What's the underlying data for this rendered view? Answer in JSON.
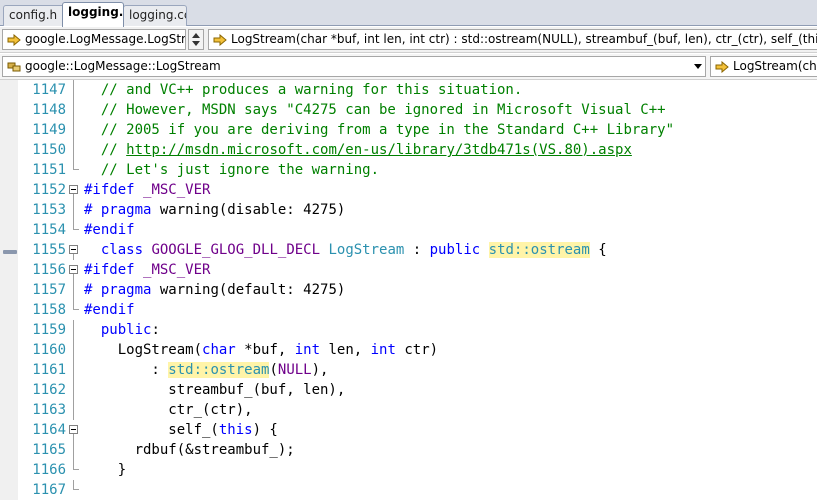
{
  "tabs": [
    {
      "label": "config.h",
      "active": false
    },
    {
      "label": "logging.h",
      "active": true
    },
    {
      "label": "logging.cc",
      "active": false
    }
  ],
  "nav": {
    "scope_combo": "google.LogMessage.LogStr",
    "member_combo": "LogStream(char *buf, int len, int ctr) : std::ostream(NULL), streambuf_(buf, len), ctr_(ctr), self_(this)",
    "class_combo": "google::LogMessage::LogStream",
    "method_combo": "LogStream(char"
  },
  "icons": {
    "member": "arrow-right-icon",
    "class": "class-icon",
    "fold": "collapse-box-icon",
    "margin": "breakpoint-margin-marker"
  },
  "colors": {
    "comment": "#008000",
    "keyword": "#0000ff",
    "macro": "#6f008a",
    "type": "#2b91af",
    "highlight": "#fff4a8"
  },
  "editor": {
    "lines": [
      {
        "num": "1147",
        "fold": "none",
        "tokens": [
          {
            "t": "  // and VC++ produces a warning for this situation.",
            "c": "c"
          }
        ]
      },
      {
        "num": "1148",
        "fold": "none",
        "tokens": [
          {
            "t": "  // However, MSDN says \"C4275 can be ignored in Microsoft Visual C++",
            "c": "c"
          }
        ]
      },
      {
        "num": "1149",
        "fold": "none",
        "tokens": [
          {
            "t": "  // 2005 if you are deriving from a type in the Standard C++ Library\"",
            "c": "c"
          }
        ]
      },
      {
        "num": "1150",
        "fold": "none",
        "tokens": [
          {
            "t": "  // ",
            "c": "c"
          },
          {
            "t": "http://msdn.microsoft.com/en-us/library/3tdb471s(VS.80).aspx",
            "c": "url"
          }
        ]
      },
      {
        "num": "1151",
        "fold": "end",
        "tokens": [
          {
            "t": "  // Let's just ignore the warning.",
            "c": "c"
          }
        ]
      },
      {
        "num": "1152",
        "fold": "box",
        "tokens": [
          {
            "t": "#ifdef",
            "c": "d"
          },
          {
            "t": " ",
            "c": ""
          },
          {
            "t": "_MSC_VER",
            "c": "m"
          }
        ]
      },
      {
        "num": "1153",
        "fold": "none",
        "tokens": [
          {
            "t": "# pragma",
            "c": "d"
          },
          {
            "t": " warning(disable: 4275)",
            "c": ""
          }
        ]
      },
      {
        "num": "1154",
        "fold": "end",
        "tokens": [
          {
            "t": "#endif",
            "c": "d"
          }
        ]
      },
      {
        "num": "1155",
        "fold": "box",
        "tokens": [
          {
            "t": "  ",
            "c": ""
          },
          {
            "t": "class",
            "c": "k"
          },
          {
            "t": " ",
            "c": ""
          },
          {
            "t": "GOOGLE_GLOG_DLL_DECL",
            "c": "m"
          },
          {
            "t": " ",
            "c": ""
          },
          {
            "t": "LogStream",
            "c": "t"
          },
          {
            "t": " : ",
            "c": ""
          },
          {
            "t": "public",
            "c": "k"
          },
          {
            "t": " ",
            "c": ""
          },
          {
            "t": "std::ostream",
            "c": "t hl"
          },
          {
            "t": " {",
            "c": ""
          }
        ]
      },
      {
        "num": "1156",
        "fold": "box",
        "tokens": [
          {
            "t": "#ifdef",
            "c": "d"
          },
          {
            "t": " ",
            "c": ""
          },
          {
            "t": "_MSC_VER",
            "c": "m"
          }
        ]
      },
      {
        "num": "1157",
        "fold": "none",
        "tokens": [
          {
            "t": "# pragma",
            "c": "d"
          },
          {
            "t": " warning(default: 4275)",
            "c": ""
          }
        ]
      },
      {
        "num": "1158",
        "fold": "end",
        "tokens": [
          {
            "t": "#endif",
            "c": "d"
          }
        ]
      },
      {
        "num": "1159",
        "fold": "none",
        "tokens": [
          {
            "t": "  ",
            "c": ""
          },
          {
            "t": "public",
            "c": "k"
          },
          {
            "t": ":",
            "c": ""
          }
        ]
      },
      {
        "num": "1160",
        "fold": "none",
        "tokens": [
          {
            "t": "    LogStream(",
            "c": ""
          },
          {
            "t": "char",
            "c": "k"
          },
          {
            "t": " *buf, ",
            "c": ""
          },
          {
            "t": "int",
            "c": "k"
          },
          {
            "t": " len, ",
            "c": ""
          },
          {
            "t": "int",
            "c": "k"
          },
          {
            "t": " ctr)",
            "c": ""
          }
        ]
      },
      {
        "num": "1161",
        "fold": "none",
        "tokens": [
          {
            "t": "        : ",
            "c": ""
          },
          {
            "t": "std::ostream",
            "c": "t hl"
          },
          {
            "t": "(",
            "c": ""
          },
          {
            "t": "NULL",
            "c": "m"
          },
          {
            "t": "),",
            "c": ""
          }
        ]
      },
      {
        "num": "1162",
        "fold": "none",
        "tokens": [
          {
            "t": "          streambuf_(buf, len),",
            "c": ""
          }
        ]
      },
      {
        "num": "1163",
        "fold": "none",
        "tokens": [
          {
            "t": "          ctr_(ctr),",
            "c": ""
          }
        ]
      },
      {
        "num": "1164",
        "fold": "box",
        "tokens": [
          {
            "t": "          self_(",
            "c": ""
          },
          {
            "t": "this",
            "c": "k"
          },
          {
            "t": ") {",
            "c": ""
          }
        ]
      },
      {
        "num": "1165",
        "fold": "none",
        "tokens": [
          {
            "t": "      rdbuf(&streambuf_);",
            "c": ""
          }
        ]
      },
      {
        "num": "1166",
        "fold": "end",
        "tokens": [
          {
            "t": "    }",
            "c": ""
          }
        ]
      },
      {
        "num": "1167",
        "fold": "end",
        "tokens": []
      }
    ]
  }
}
